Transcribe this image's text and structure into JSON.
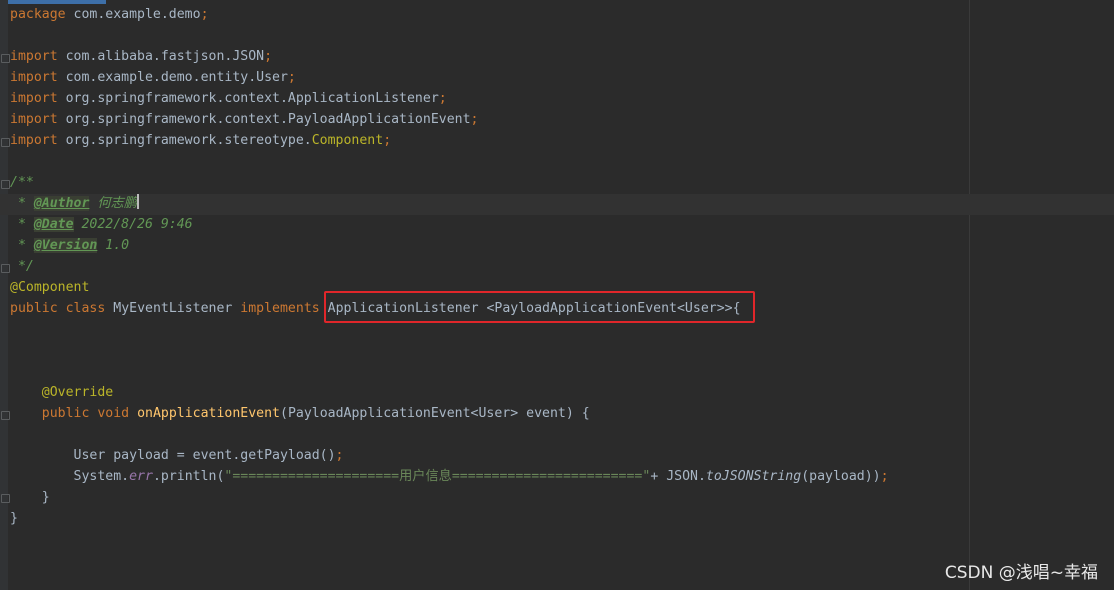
{
  "code": {
    "package_kw": "package",
    "package_name": "com.example.demo",
    "semicolon": ";",
    "import_kw": "import",
    "imports": [
      "com.alibaba.fastjson.JSON",
      "com.example.demo.entity.User",
      "org.springframework.context.ApplicationListener",
      "org.springframework.context.PayloadApplicationEvent",
      "org.springframework.stereotype."
    ],
    "import_last_class": "Component",
    "doc_open": "/**",
    "doc_star": " * ",
    "doc_close": " */",
    "doc_author_tag": "@Author",
    "doc_author_value": " 何志鹏",
    "doc_date_tag": "@Date",
    "doc_date_value": " 2022/8/26 9:46",
    "doc_version_tag": "@Version",
    "doc_version_value": " 1.0",
    "class_annotation": "@Component",
    "public_kw": "public",
    "class_kw": "class",
    "class_name": "MyEventListener",
    "implements_kw": "implements",
    "implemented_type": "ApplicationListener <PayloadApplicationEvent<User>>{",
    "override_annotation": "@Override",
    "void_kw": "void",
    "method_name": "onApplicationEvent",
    "method_params": "(PayloadApplicationEvent<User> event) {",
    "payload_line": "User payload = event.getPayload()",
    "system_text": "System.",
    "err_field": "err",
    "println_open": ".println(",
    "string_literal": "\"=====================用户信息========================\"",
    "concat_text": "+ JSON.",
    "to_json_method": "toJSONString",
    "println_close": "(payload))",
    "method_close": "}",
    "class_close": "}"
  },
  "watermark": "CSDN @浅唱~幸福",
  "colors": {
    "background": "#2b2b2b",
    "keyword": "#cc7832",
    "annotation": "#bbb529",
    "method_declaration": "#ffc66d",
    "string": "#6a8759",
    "doc_comment": "#629755",
    "field": "#9876aa",
    "default_text": "#a9b7c6",
    "highlight_box": "#e0262a"
  }
}
